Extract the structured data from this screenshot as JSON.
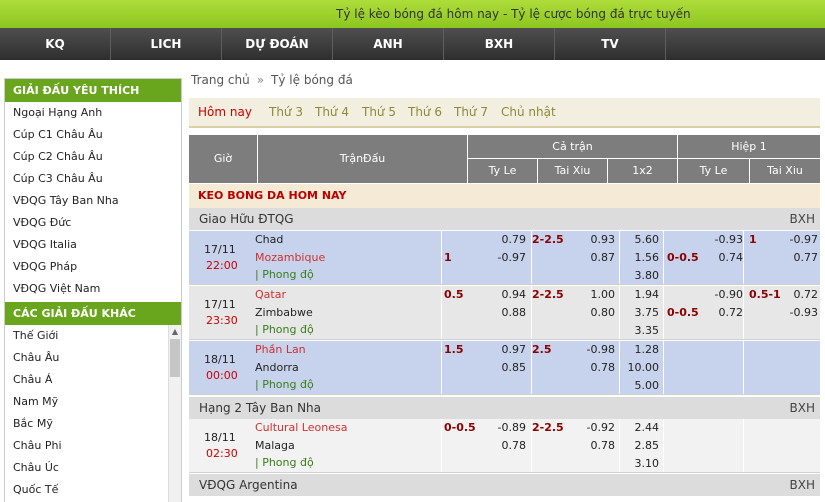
{
  "header": {
    "title": "Tỷ lệ kèo bóng đá hôm nay - Tỷ lệ cược bóng đá trực tuyến"
  },
  "nav": [
    "KQ",
    "LICH",
    "DỰ ĐOÁN",
    "ANH",
    "BXH",
    "TV"
  ],
  "sidebar": {
    "fav_title": "GIẢI ĐẤU YÊU THÍCH",
    "fav": [
      "Ngoại Hạng Anh",
      "Cúp C1 Châu Âu",
      "Cúp C2 Châu Âu",
      "Cúp C3 Châu Âu",
      "VĐQG Tây Ban Nha",
      "VĐQG Đức",
      "VĐQG Italia",
      "VĐQG Pháp",
      "VĐQG Việt Nam"
    ],
    "other_title": "CÁC GIẢI ĐẤU KHÁC",
    "other": [
      "Thế Giới",
      "Châu Âu",
      "Châu Á",
      "Nam Mỹ",
      "Bắc Mỹ",
      "Châu Phi",
      "Châu Úc",
      "Quốc Tế"
    ]
  },
  "breadcrumb": {
    "home": "Trang chủ",
    "sep": "»",
    "current": "Tỷ lệ bóng đá"
  },
  "tabs": [
    "Hôm nay",
    "Thứ 3",
    "Thứ 4",
    "Thứ 5",
    "Thứ 6",
    "Thứ 7",
    "Chủ nhật"
  ],
  "table_header": {
    "gio": "Giờ",
    "tran": "TrậnĐấu",
    "ca_tran": "Cả trận",
    "hiep1": "Hiệp 1",
    "tyle": "Ty Le",
    "taixiu": "Tai Xiu",
    "x12": "1x2",
    "tyle2": "Ty Le",
    "taixiu2": "Tai Xiu"
  },
  "banner": "KEO BONG DA HOM NAY",
  "leagues": [
    {
      "name": "Giao Hữu ĐTQG",
      "bxh": "BXH"
    },
    {
      "name": "Hạng 2 Tây Ban Nha",
      "bxh": "BXH"
    },
    {
      "name": "VĐQG Argentina",
      "bxh": "BXH"
    }
  ],
  "form_label": "| Phong độ",
  "matches": [
    {
      "date": "17/11",
      "time": "22:00",
      "home": "Chad",
      "away": "Mozambique",
      "home_red": false,
      "away_red": true,
      "hc": "1",
      "hc_row": "away",
      "ty_h": "0.79",
      "ty_a": "-0.97",
      "tx_line": "2-2.5",
      "tx_o": "0.93",
      "tx_u": "0.87",
      "x1": "5.60",
      "x2": "1.56",
      "x3": "3.80",
      "h1_hc": "0-0.5",
      "h1_ty_h": "-0.93",
      "h1_ty_a": "0.74",
      "h1_tx_line": "1",
      "h1_tx_o": "-0.97",
      "h1_tx_u": "0.77"
    },
    {
      "date": "17/11",
      "time": "23:30",
      "home": "Qatar",
      "away": "Zimbabwe",
      "home_red": true,
      "away_red": false,
      "hc": "0.5",
      "hc_row": "home",
      "ty_h": "0.94",
      "ty_a": "0.88",
      "tx_line": "2-2.5",
      "tx_o": "1.00",
      "tx_u": "0.80",
      "x1": "1.94",
      "x2": "3.75",
      "x3": "3.35",
      "h1_hc": "0-0.5",
      "h1_ty_h": "-0.90",
      "h1_ty_a": "0.72",
      "h1_tx_line": "0.5-1",
      "h1_tx_o": "0.72",
      "h1_tx_u": "-0.93"
    },
    {
      "date": "18/11",
      "time": "00:00",
      "home": "Phần Lan",
      "away": "Andorra",
      "home_red": true,
      "away_red": false,
      "hc": "1.5",
      "hc_row": "home",
      "ty_h": "0.97",
      "ty_a": "0.85",
      "tx_line": "2.5",
      "tx_o": "-0.98",
      "tx_u": "0.78",
      "x1": "1.28",
      "x2": "10.00",
      "x3": "5.00",
      "h1_hc": "",
      "h1_ty_h": "",
      "h1_ty_a": "",
      "h1_tx_line": "",
      "h1_tx_o": "",
      "h1_tx_u": ""
    },
    {
      "date": "18/11",
      "time": "02:30",
      "home": "Cultural Leonesa",
      "away": "Malaga",
      "home_red": true,
      "away_red": false,
      "hc": "0-0.5",
      "hc_row": "home",
      "ty_h": "-0.89",
      "ty_a": "0.78",
      "tx_line": "2-2.5",
      "tx_o": "-0.92",
      "tx_u": "0.78",
      "x1": "2.44",
      "x2": "2.85",
      "x3": "3.10",
      "h1_hc": "",
      "h1_ty_h": "",
      "h1_ty_a": "",
      "h1_tx_line": "",
      "h1_tx_o": "",
      "h1_tx_u": ""
    }
  ]
}
